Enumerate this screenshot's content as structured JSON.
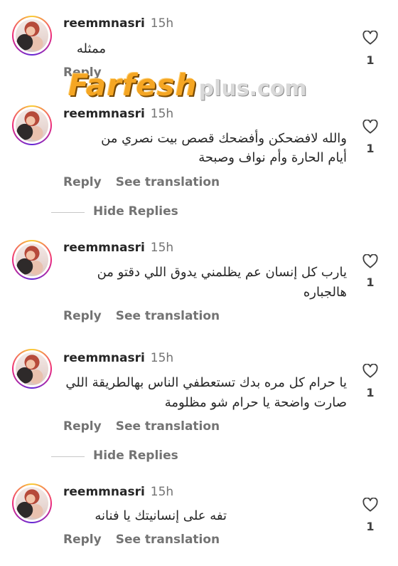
{
  "comments": [
    {
      "username": "reemmnasri",
      "time": "15h",
      "text": "ممثله",
      "likes": "1",
      "reply_label": "Reply"
    },
    {
      "username": "reemmnasri",
      "time": "15h",
      "text_line1": "والله لافضحكن وأفضحك قصص بيت نصري من",
      "text_line2": "أيام الحارة وأم نواف وصبحة",
      "likes": "1",
      "reply_label": "Reply",
      "translate_label": "See translation"
    },
    {
      "username": "reemmnasri",
      "time": "15h",
      "text_line1": "يارب كل إنسان عم يظلمني يدوق اللي دقتو من",
      "text_line2": "هالجباره",
      "likes": "1",
      "reply_label": "Reply",
      "translate_label": "See translation"
    },
    {
      "username": "reemmnasri",
      "time": "15h",
      "text_line1": "يا حرام كل مره بدك تستعطفي الناس بهالطريقة اللي",
      "text_line2": "صارت واضحة يا حرام شو مظلومة",
      "likes": "1",
      "reply_label": "Reply",
      "translate_label": "See translation"
    },
    {
      "username": "reemmnasri",
      "time": "15h",
      "text": "تفه على إنسانيتك يا فنانه",
      "likes": "1",
      "reply_label": "Reply",
      "translate_label": "See translation"
    }
  ],
  "hide_replies_label": "Hide Replies",
  "watermark": {
    "main": "Farfesh",
    "sub": "plus.com"
  },
  "colors": {
    "text": "#262626",
    "secondary": "#737373",
    "watermark_orange": "#f5a623"
  },
  "icons": {
    "like": "heart-icon"
  }
}
